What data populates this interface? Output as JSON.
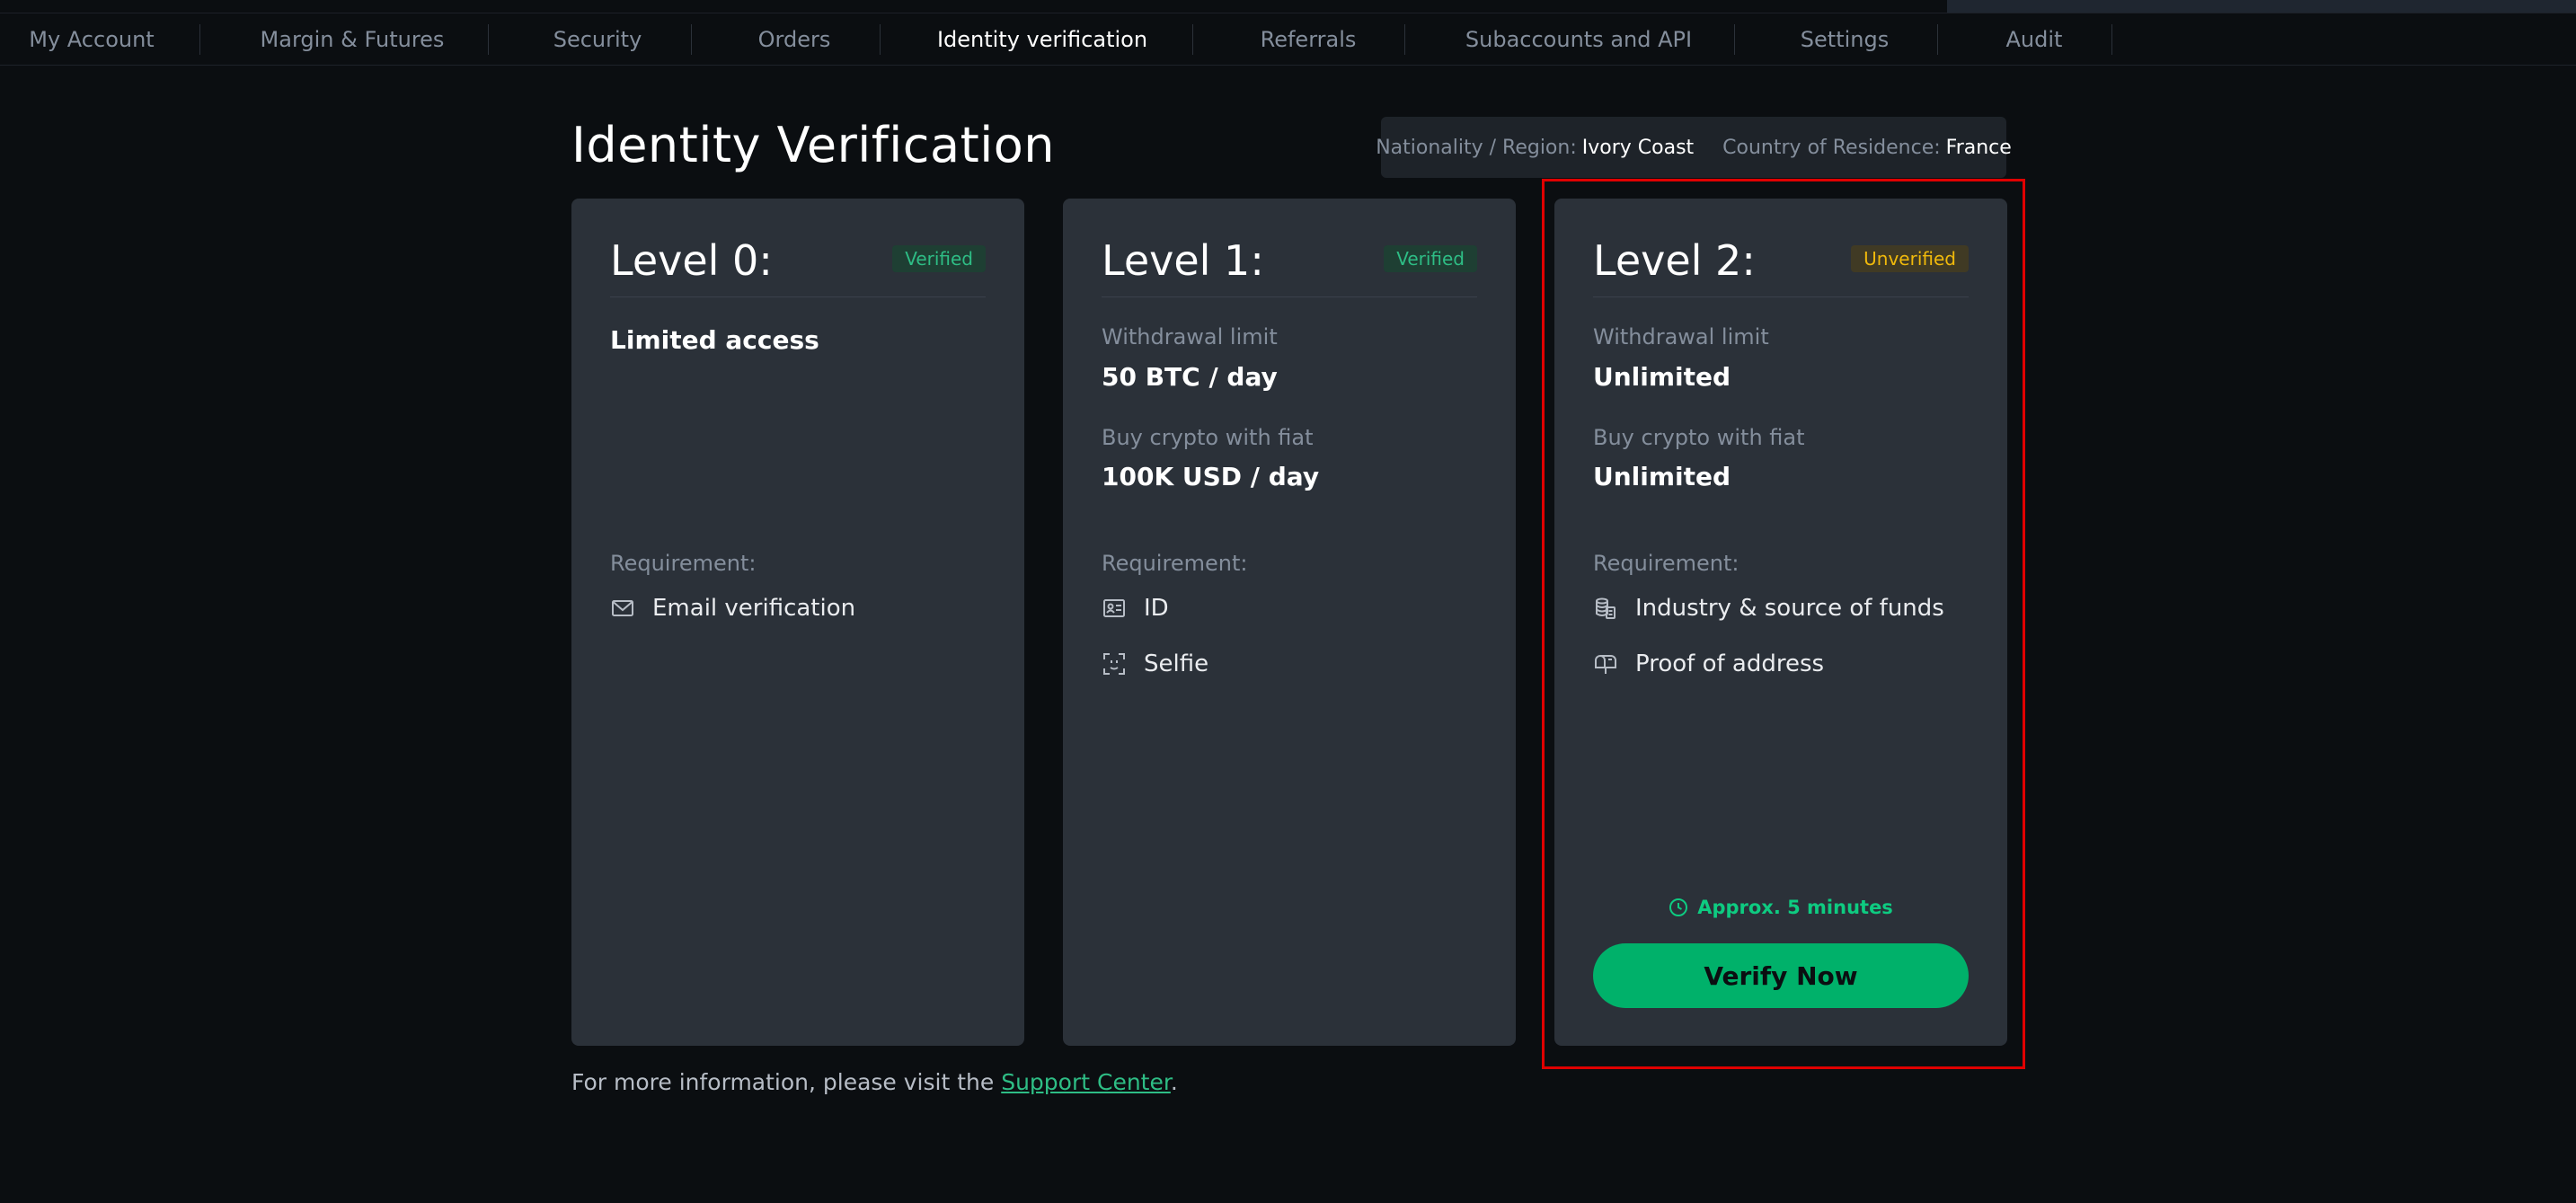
{
  "nav": {
    "items": [
      {
        "label": "My Account",
        "active": false
      },
      {
        "label": "Margin & Futures",
        "active": false
      },
      {
        "label": "Security",
        "active": false
      },
      {
        "label": "Orders",
        "active": false
      },
      {
        "label": "Identity verification",
        "active": true
      },
      {
        "label": "Referrals",
        "active": false
      },
      {
        "label": "Subaccounts and API",
        "active": false
      },
      {
        "label": "Settings",
        "active": false
      },
      {
        "label": "Audit",
        "active": false
      }
    ]
  },
  "page": {
    "title": "Identity Verification"
  },
  "region": {
    "nationality_label": "Nationality / Region:",
    "nationality_value": "Ivory Coast",
    "residence_label": "Country of Residence:",
    "residence_value": "France"
  },
  "levels": [
    {
      "title": "Level 0:",
      "status": "Verified",
      "headline": "Limited access",
      "requirement_label": "Requirement:",
      "requirements": [
        {
          "label": "Email verification",
          "icon": "mail-icon"
        }
      ]
    },
    {
      "title": "Level 1:",
      "status": "Verified",
      "withdrawal_label": "Withdrawal limit",
      "withdrawal_value": "50 BTC / day",
      "fiat_label": "Buy crypto with fiat",
      "fiat_value": "100K USD / day",
      "requirement_label": "Requirement:",
      "requirements": [
        {
          "label": "ID",
          "icon": "id-card-icon"
        },
        {
          "label": "Selfie",
          "icon": "face-scan-icon"
        }
      ]
    },
    {
      "title": "Level 2:",
      "status": "Unverified",
      "withdrawal_label": "Withdrawal limit",
      "withdrawal_value": "Unlimited",
      "fiat_label": "Buy crypto with fiat",
      "fiat_value": "Unlimited",
      "requirement_label": "Requirement:",
      "requirements": [
        {
          "label": "Industry & source of funds",
          "icon": "coins-document-icon"
        },
        {
          "label": "Proof of address",
          "icon": "mailbox-icon"
        }
      ],
      "approx_time": "Approx. 5 minutes",
      "action_label": "Verify Now"
    }
  ],
  "footer": {
    "prefix": "For more information, please visit the",
    "link_text": "Support Center",
    "suffix": "."
  },
  "colors": {
    "background": "#0b0e11",
    "card": "#2b3139",
    "accent_green": "#00b16a",
    "verified_text": "#2ebd85",
    "unverified_text": "#f0b90b",
    "highlight_border": "#e00000"
  }
}
